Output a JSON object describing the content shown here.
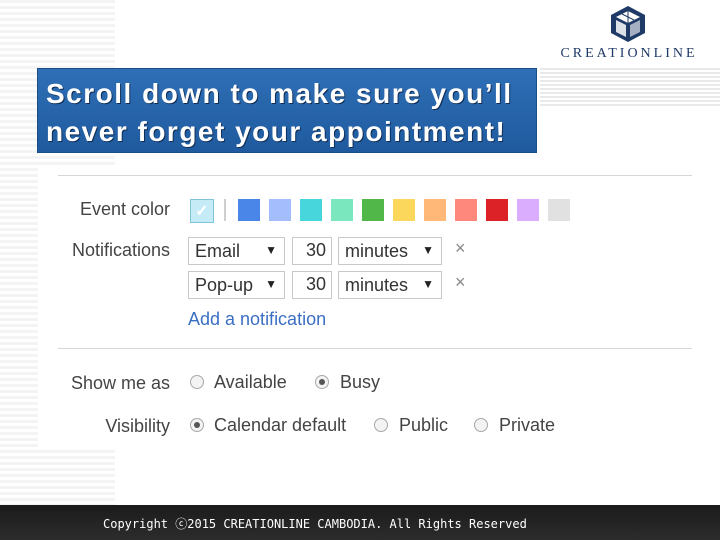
{
  "logo": {
    "text": "CREATIONLINE",
    "icon": "cube-logo-icon",
    "color": "#1f3a66"
  },
  "banner": {
    "line1": "Scroll down to make sure you’ll",
    "line2": "never forget your appointment!",
    "color": "#2f6fb6"
  },
  "event_color": {
    "label": "Event color",
    "selected_icon": "checkmark-icon",
    "swatches": [
      "#c5ecf6",
      "#4a86e8",
      "#a4bdfc",
      "#46d6db",
      "#7ae7bf",
      "#51b749",
      "#fbd75b",
      "#ffb878",
      "#ff887c",
      "#dc2127",
      "#dbadff",
      "#e1e1e1"
    ]
  },
  "notifications": {
    "label": "Notifications",
    "items": [
      {
        "type": "Email",
        "amount": "30",
        "unit": "minutes"
      },
      {
        "type": "Pop-up",
        "amount": "30",
        "unit": "minutes"
      }
    ],
    "remove_symbol": "×",
    "add_label": "Add a notification"
  },
  "show_me_as": {
    "label": "Show me as",
    "options": [
      "Available",
      "Busy"
    ],
    "selected": "Busy"
  },
  "visibility": {
    "label": "Visibility",
    "options": [
      "Calendar default",
      "Public",
      "Private"
    ],
    "selected": "Calendar default"
  },
  "dropdown_arrow": "▼",
  "footer": {
    "text": "Copyright ⓒ2015 CREATIONLINE CAMBODIA. All Rights Reserved"
  }
}
